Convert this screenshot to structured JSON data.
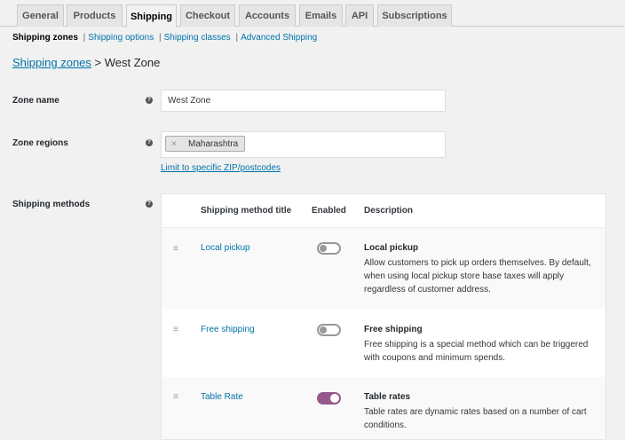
{
  "tabs": [
    {
      "label": "General"
    },
    {
      "label": "Products"
    },
    {
      "label": "Shipping",
      "active": true
    },
    {
      "label": "Checkout"
    },
    {
      "label": "Accounts"
    },
    {
      "label": "Emails"
    },
    {
      "label": "API"
    },
    {
      "label": "Subscriptions"
    }
  ],
  "subnav": {
    "current": "Shipping zones",
    "links": [
      "Shipping options",
      "Shipping classes",
      "Advanced Shipping"
    ],
    "separator": "|"
  },
  "heading": {
    "link": "Shipping zones",
    "rest": "> West Zone"
  },
  "help_glyph": "?",
  "zone_name": {
    "label": "Zone name",
    "value": "West Zone"
  },
  "zone_regions": {
    "label": "Zone regions",
    "chip": "Maharashtra",
    "chip_remove": "×",
    "limit_link": "Limit to specific ZIP/postcodes"
  },
  "shipping_methods": {
    "label": "Shipping methods",
    "columns": [
      "Shipping method title",
      "Enabled",
      "Description"
    ],
    "drag_glyph": "≡",
    "rows": [
      {
        "title": "Local pickup",
        "enabled": false,
        "desc_title": "Local pickup",
        "desc": "Allow customers to pick up orders themselves. By default, when using local pickup store base taxes will apply regardless of customer address."
      },
      {
        "title": "Free shipping",
        "enabled": false,
        "desc_title": "Free shipping",
        "desc": "Free shipping is a special method which can be triggered with coupons and minimum spends."
      },
      {
        "title": "Table Rate",
        "enabled": true,
        "desc_title": "Table rates",
        "desc": "Table rates are dynamic rates based on a number of cart conditions."
      }
    ]
  },
  "colors": {
    "link": "#0073aa",
    "toggle_on": "#96588a",
    "toggle_off": "#999999"
  }
}
